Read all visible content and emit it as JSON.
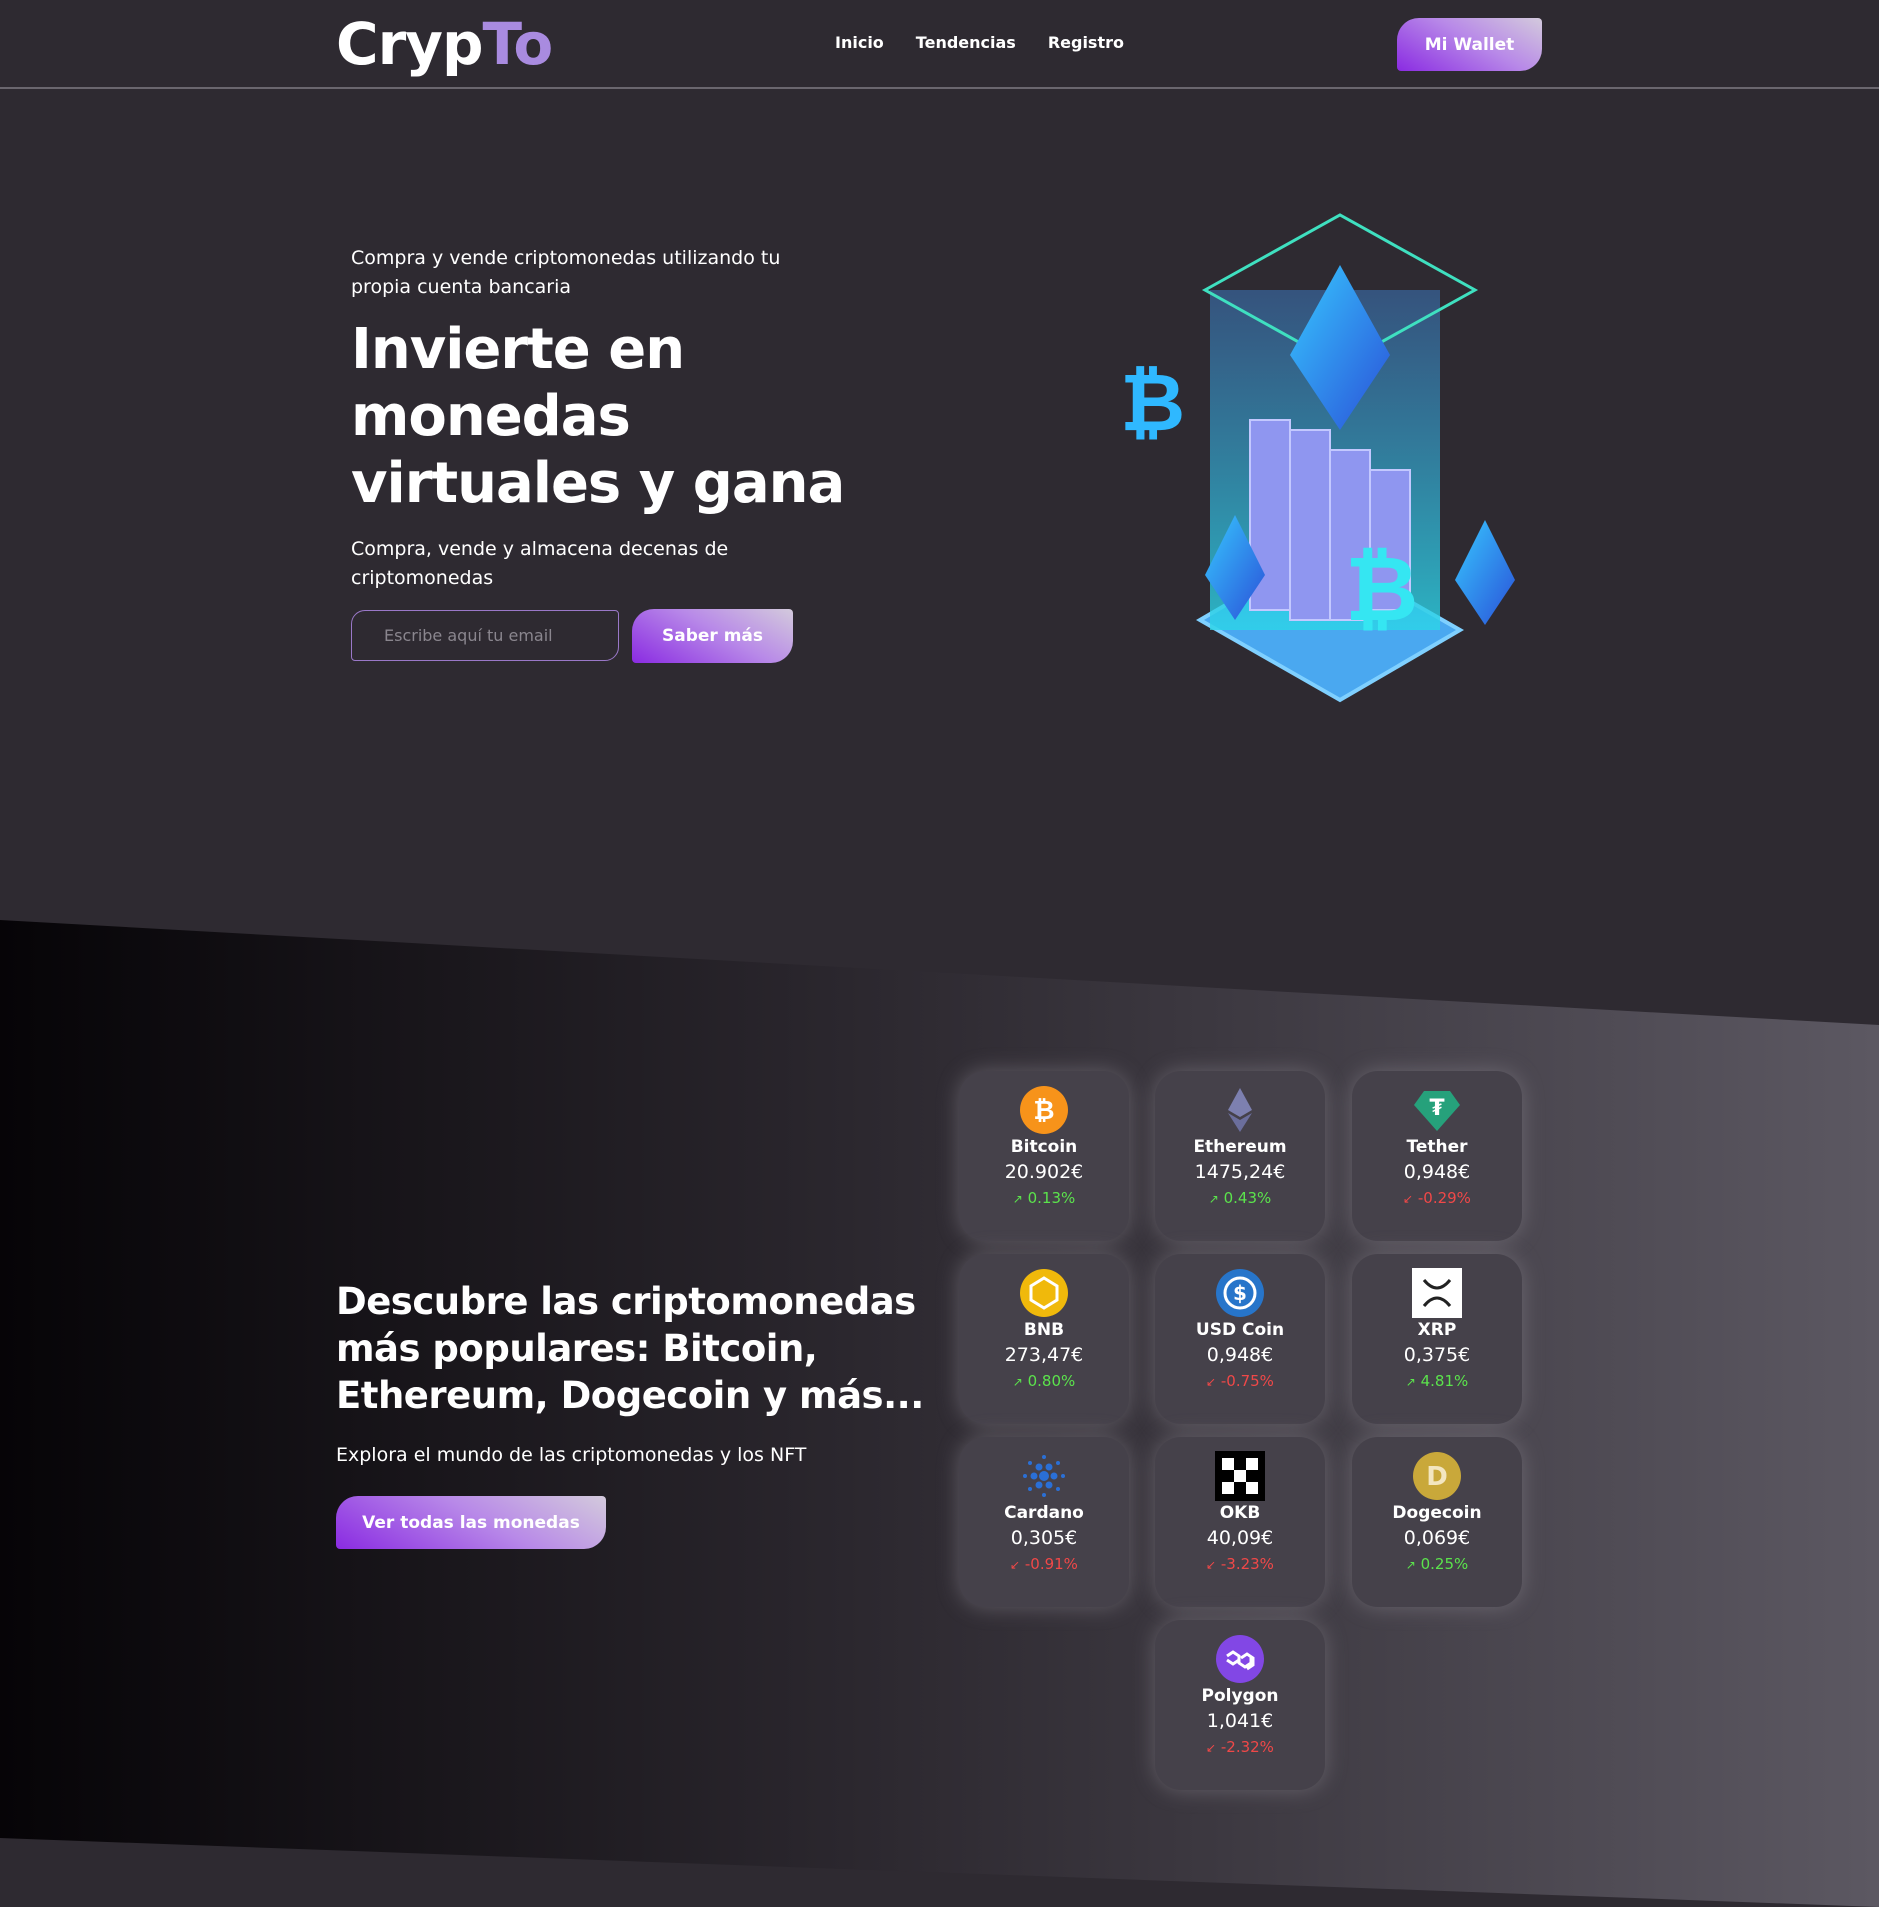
{
  "header": {
    "logo_main": "Cryp",
    "logo_accent": "To",
    "nav": [
      "Inicio",
      "Tendencias",
      "Registro"
    ],
    "wallet_button": "Mi Wallet"
  },
  "hero": {
    "subtitle": "Compra y vende criptomonedas utilizando tu propia cuenta bancaria",
    "title": "Invierte en monedas virtuales y gana",
    "text": "Compra, vende y almacena decenas de criptomonedas",
    "email_placeholder": "Escribe aquí tu email",
    "cta": "Saber más"
  },
  "popular": {
    "title": "Descubre las criptomonedas más populares: Bitcoin, Ethereum, Dogecoin y más...",
    "text": "Explora el mundo de las criptomonedas y los NFT",
    "cta": "Ver todas las monedas",
    "coins": [
      {
        "name": "Bitcoin",
        "price": "20.902€",
        "change": "0.13%",
        "dir": "up",
        "icon": "bitcoin-icon"
      },
      {
        "name": "Ethereum",
        "price": "1475,24€",
        "change": "0.43%",
        "dir": "up",
        "icon": "ethereum-icon"
      },
      {
        "name": "Tether",
        "price": "0,948€",
        "change": "-0.29%",
        "dir": "down",
        "icon": "tether-icon"
      },
      {
        "name": "BNB",
        "price": "273,47€",
        "change": "0.80%",
        "dir": "up",
        "icon": "bnb-icon"
      },
      {
        "name": "USD Coin",
        "price": "0,948€",
        "change": "-0.75%",
        "dir": "down",
        "icon": "usd-coin-icon"
      },
      {
        "name": "XRP",
        "price": "0,375€",
        "change": "4.81%",
        "dir": "up",
        "icon": "xrp-icon"
      },
      {
        "name": "Cardano",
        "price": "0,305€",
        "change": "-0.91%",
        "dir": "down",
        "icon": "cardano-icon"
      },
      {
        "name": "OKB",
        "price": "40,09€",
        "change": "-3.23%",
        "dir": "down",
        "icon": "okb-icon"
      },
      {
        "name": "Dogecoin",
        "price": "0,069€",
        "change": "0.25%",
        "dir": "up",
        "icon": "dogecoin-icon"
      },
      {
        "name": "Polygon",
        "price": "1,041€",
        "change": "-2.32%",
        "dir": "down",
        "icon": "polygon-icon"
      }
    ]
  },
  "colors": {
    "accent": "#8a2be2",
    "up": "#5be34c",
    "down": "#f04848"
  }
}
